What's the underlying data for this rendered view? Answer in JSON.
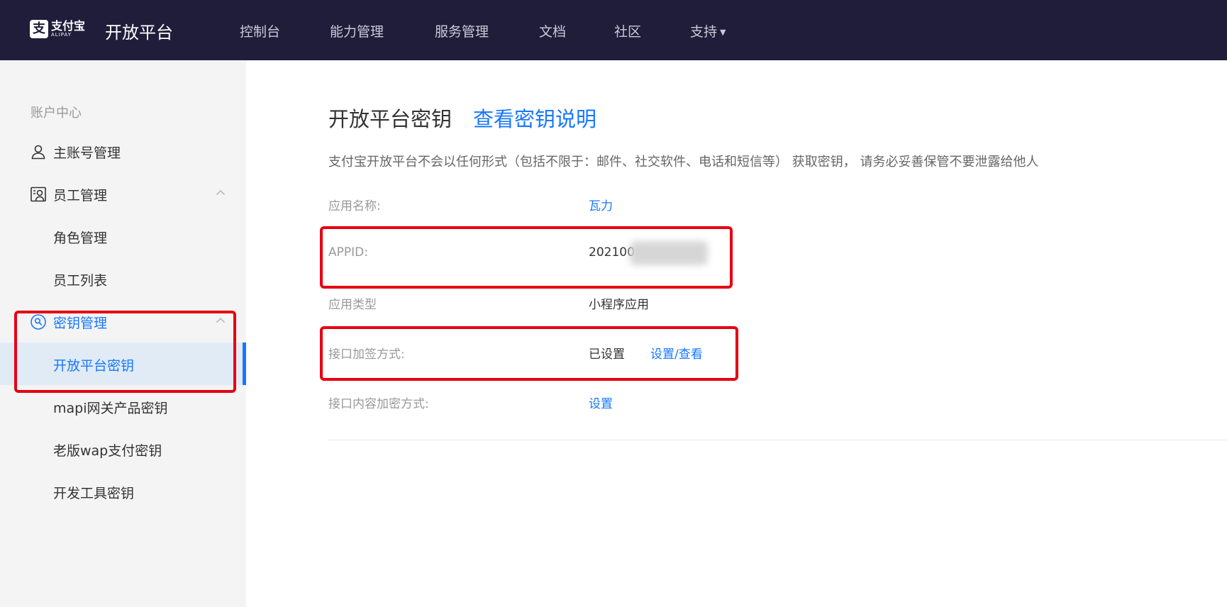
{
  "header": {
    "logo_cn": "支付宝",
    "logo_en": "ALIPAY",
    "logo_mark": "支",
    "platform_name": "开放平台",
    "nav": [
      {
        "label": "控制台"
      },
      {
        "label": "能力管理"
      },
      {
        "label": "服务管理"
      },
      {
        "label": "文档"
      },
      {
        "label": "社区"
      },
      {
        "label": "支持"
      }
    ],
    "dropdown_icon": "caret-down-icon"
  },
  "sidebar": {
    "heading": "账户中心",
    "items": [
      {
        "label": "主账号管理",
        "icon": "user-icon"
      },
      {
        "label": "员工管理",
        "icon": "staff-icon",
        "expanded": true
      },
      {
        "label": "角色管理"
      },
      {
        "label": "员工列表"
      },
      {
        "label": "密钥管理",
        "icon": "key-search-icon",
        "expanded": true
      },
      {
        "label": "开放平台密钥",
        "active": true
      },
      {
        "label": "mapi网关产品密钥"
      },
      {
        "label": "老版wap支付密钥"
      },
      {
        "label": "开发工具密钥"
      }
    ]
  },
  "main": {
    "title": "开放平台密钥",
    "title_link": "查看密钥说明",
    "notice": "支付宝开放平台不会以任何形式（包括不限于：邮件、社交软件、电话和短信等） 获取密钥， 请务必妥善保管不要泄露给他人",
    "fields": [
      {
        "label": "应用名称:",
        "value": "瓦力"
      },
      {
        "label": "APPID:",
        "value": "202100"
      },
      {
        "label": "应用类型",
        "value": "小程序应用"
      },
      {
        "label": "接口加签方式:",
        "value": "已设置",
        "action": "设置/查看"
      },
      {
        "label": "接口内容加密方式:",
        "value": "设置"
      }
    ]
  },
  "colors": {
    "header_bg": "#1f1d3a",
    "accent": "#1677ff",
    "highlight": "#e60012",
    "sidebar_bg": "#f4f4f4",
    "active_bg": "#e0ebf6"
  }
}
